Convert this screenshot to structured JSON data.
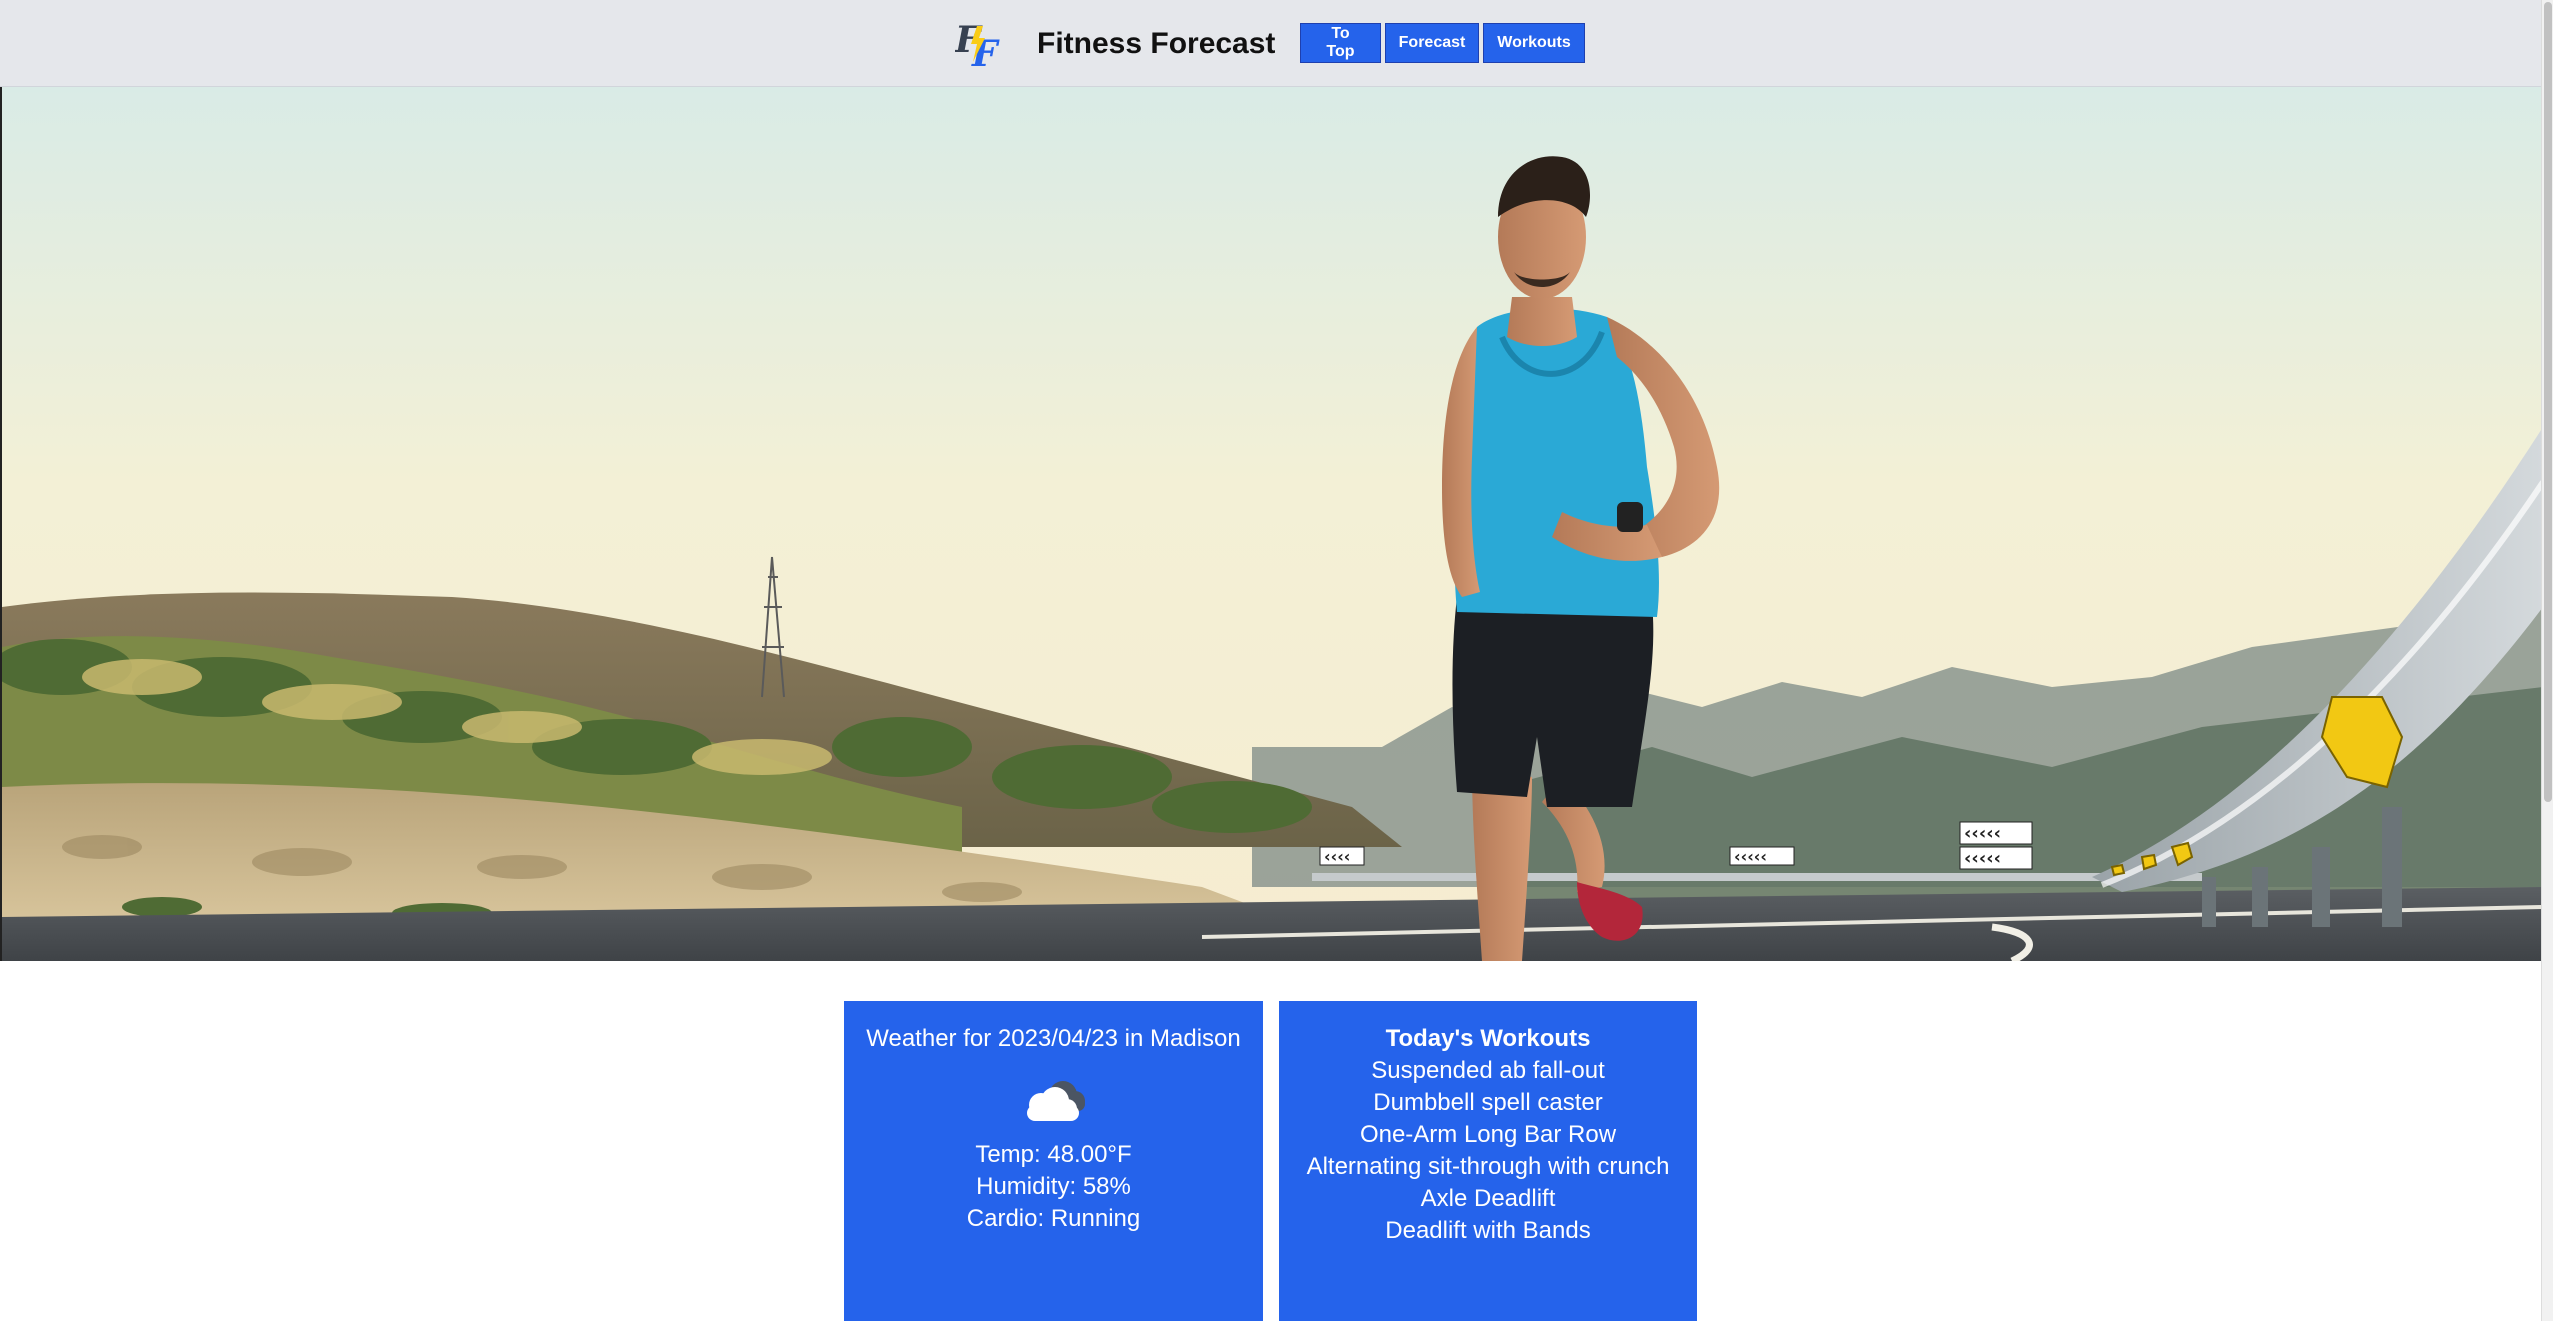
{
  "header": {
    "logo_text": "FF",
    "title": "Fitness Forecast",
    "nav": {
      "to_top": "To Top",
      "forecast": "Forecast",
      "workouts": "Workouts"
    }
  },
  "weather": {
    "heading": "Weather for 2023/04/23 in Madison",
    "icon": "cloud-icon",
    "temp": "Temp: 48.00°F",
    "humidity": "Humidity: 58%",
    "cardio": "Cardio: Running"
  },
  "workouts": {
    "heading": "Today's Workouts",
    "items": [
      "Suspended ab fall-out",
      "Dumbbell spell caster",
      "One-Arm Long Bar Row",
      "Alternating sit-through with crunch",
      "Axle Deadlift",
      "Deadlift with Bands"
    ]
  },
  "colors": {
    "accent": "#2563eb",
    "header_bg": "#e5e7eb",
    "logo_yellow": "#facc15"
  }
}
